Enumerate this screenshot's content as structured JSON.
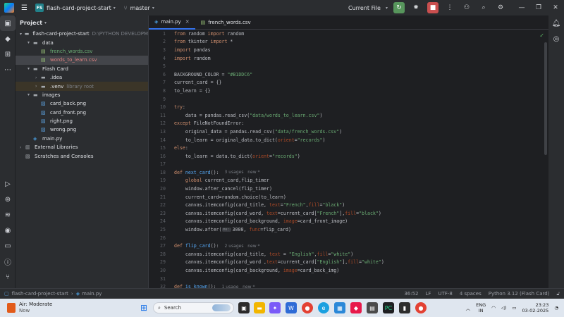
{
  "titlebar": {
    "project_badge": "FS",
    "project_name": "flash-card-project-start",
    "branch": "master",
    "run_config": "Current File"
  },
  "project_panel": {
    "header": "Project",
    "tree": [
      {
        "indent": 0,
        "arrow": "▾",
        "icon": "folder",
        "label": "flash-card-project-start",
        "note": "D:\\PYTHON DEVELOPM",
        "cls": ""
      },
      {
        "indent": 1,
        "arrow": "▾",
        "icon": "folder",
        "label": "data",
        "note": "",
        "cls": ""
      },
      {
        "indent": 2,
        "arrow": "",
        "icon": "csv",
        "label": "french_words.csv",
        "note": "",
        "cls": "green"
      },
      {
        "indent": 2,
        "arrow": "",
        "icon": "csv",
        "label": "words_to_learn.csv",
        "note": "",
        "cls": "red-sel"
      },
      {
        "indent": 1,
        "arrow": "▾",
        "icon": "folder",
        "label": "Flash Card",
        "note": "",
        "cls": ""
      },
      {
        "indent": 2,
        "arrow": "›",
        "icon": "folder",
        "label": ".idea",
        "note": "",
        "cls": ""
      },
      {
        "indent": 2,
        "arrow": "›",
        "icon": "folder",
        "label": ".venv",
        "note": "library root",
        "cls": "excl"
      },
      {
        "indent": 1,
        "arrow": "▾",
        "icon": "folder",
        "label": "images",
        "note": "",
        "cls": ""
      },
      {
        "indent": 2,
        "arrow": "",
        "icon": "png",
        "label": "card_back.png",
        "note": "",
        "cls": ""
      },
      {
        "indent": 2,
        "arrow": "",
        "icon": "png",
        "label": "card_front.png",
        "note": "",
        "cls": ""
      },
      {
        "indent": 2,
        "arrow": "",
        "icon": "png",
        "label": "right.png",
        "note": "",
        "cls": ""
      },
      {
        "indent": 2,
        "arrow": "",
        "icon": "png",
        "label": "wrong.png",
        "note": "",
        "cls": ""
      },
      {
        "indent": 1,
        "arrow": "",
        "icon": "py",
        "label": "main.py",
        "note": "",
        "cls": ""
      },
      {
        "indent": 0,
        "arrow": "›",
        "icon": "lib",
        "label": "External Libraries",
        "note": "",
        "cls": ""
      },
      {
        "indent": 0,
        "arrow": "",
        "icon": "scratch",
        "label": "Scratches and Consoles",
        "note": "",
        "cls": ""
      }
    ]
  },
  "tabs": [
    {
      "label": "main.py",
      "active": true
    },
    {
      "label": "french_words.csv",
      "active": false
    }
  ],
  "code_lines": [
    [
      [
        "kw",
        "from"
      ],
      [
        "t",
        " random "
      ],
      [
        "kw",
        "import"
      ],
      [
        "t",
        " random"
      ]
    ],
    [
      [
        "kw",
        "from"
      ],
      [
        "t",
        " tkinter "
      ],
      [
        "kw",
        "import"
      ],
      [
        "t",
        " *"
      ]
    ],
    [
      [
        "kw",
        "import"
      ],
      [
        "t",
        " pandas"
      ]
    ],
    [
      [
        "kw",
        "import"
      ],
      [
        "t",
        " random"
      ]
    ],
    [],
    [
      [
        "t",
        "BACKGROUND_COLOR = "
      ],
      [
        "str",
        "\"#B1DDC6\""
      ]
    ],
    [
      [
        "t",
        "current_card = {}"
      ]
    ],
    [
      [
        "t",
        "to_learn = {}"
      ]
    ],
    [],
    [
      [
        "kw",
        "try"
      ],
      [
        "t",
        ":"
      ]
    ],
    [
      [
        "t",
        "    data = pandas.read_csv("
      ],
      [
        "str",
        "\"data/words_to_learn.csv\""
      ],
      [
        "t",
        ")"
      ]
    ],
    [
      [
        "kw",
        "except"
      ],
      [
        "t",
        " FileNotFoundError:"
      ]
    ],
    [
      [
        "t",
        "    original_data = pandas.read_csv("
      ],
      [
        "str",
        "\"data/french_words.csv\""
      ],
      [
        "t",
        ")"
      ]
    ],
    [
      [
        "t",
        "    to_learn = original_data.to_dict("
      ],
      [
        "param",
        "orient"
      ],
      [
        "t",
        "="
      ],
      [
        "str",
        "\"records\""
      ],
      [
        "t",
        ")"
      ]
    ],
    [
      [
        "kw",
        "else"
      ],
      [
        "t",
        ":"
      ]
    ],
    [
      [
        "t",
        "    to_learn = data.to_dict("
      ],
      [
        "param",
        "orient"
      ],
      [
        "t",
        "="
      ],
      [
        "str",
        "\"records\""
      ],
      [
        "t",
        ")"
      ]
    ],
    [],
    [
      [
        "kw",
        "def "
      ],
      [
        "fn",
        "next_card"
      ],
      [
        "t",
        "():"
      ],
      [
        "hint",
        "3 usages   new *"
      ]
    ],
    [
      [
        "kw",
        "    global"
      ],
      [
        "t",
        " current_card,flip_timer"
      ]
    ],
    [
      [
        "t",
        "    window.after_cancel(flip_timer)"
      ]
    ],
    [
      [
        "t",
        "    current_card=random.choice(to_learn)"
      ]
    ],
    [
      [
        "t",
        "    canvas.itemconfig(card_title, "
      ],
      [
        "param",
        "text"
      ],
      [
        "t",
        "="
      ],
      [
        "str",
        "\"French\""
      ],
      [
        "t",
        ","
      ],
      [
        "param",
        "fill"
      ],
      [
        "t",
        "="
      ],
      [
        "str",
        "\"black\""
      ],
      [
        "t",
        ")"
      ]
    ],
    [
      [
        "t",
        "    canvas.itemconfig(card_word, "
      ],
      [
        "param",
        "text"
      ],
      [
        "t",
        "=current_card["
      ],
      [
        "str",
        "\"French\""
      ],
      [
        "t",
        "],"
      ],
      [
        "param",
        "fill"
      ],
      [
        "t",
        "="
      ],
      [
        "str",
        "\"black\""
      ],
      [
        "t",
        ")"
      ]
    ],
    [
      [
        "t",
        "    canvas.itemconfig(card_background, "
      ],
      [
        "param",
        "image"
      ],
      [
        "t",
        "=card_front_image)"
      ]
    ],
    [
      [
        "t",
        "    window.after("
      ],
      [
        "inlay",
        "ms:"
      ],
      [
        "t",
        "3000, "
      ],
      [
        "param",
        "func"
      ],
      [
        "t",
        "=flip_card)"
      ]
    ],
    [],
    [
      [
        "kw",
        "def "
      ],
      [
        "fn",
        "flip_card"
      ],
      [
        "t",
        "():"
      ],
      [
        "hint",
        "2 usages   new *"
      ]
    ],
    [
      [
        "t",
        "    canvas.itemconfig(card_title, "
      ],
      [
        "param",
        "text"
      ],
      [
        "t",
        " = "
      ],
      [
        "str",
        "\"English\""
      ],
      [
        "t",
        ","
      ],
      [
        "param",
        "fill"
      ],
      [
        "t",
        "="
      ],
      [
        "str",
        "\"white\""
      ],
      [
        "t",
        ")"
      ]
    ],
    [
      [
        "t",
        "    canvas.itemconfig(card_word ,"
      ],
      [
        "param",
        "text"
      ],
      [
        "t",
        "=current_card["
      ],
      [
        "str",
        "\"English\""
      ],
      [
        "t",
        "],"
      ],
      [
        "param",
        "fill"
      ],
      [
        "t",
        "="
      ],
      [
        "str",
        "\"white\""
      ],
      [
        "t",
        ")"
      ]
    ],
    [
      [
        "t",
        "    canvas.itemconfig(card_background, "
      ],
      [
        "param",
        "image"
      ],
      [
        "t",
        "=card_back_img)"
      ]
    ],
    [],
    [
      [
        "kw",
        "def "
      ],
      [
        "fn",
        "is_known"
      ],
      [
        "t",
        "():"
      ],
      [
        "hint",
        "1 usage   new *"
      ]
    ]
  ],
  "statusbar": {
    "path_project": "flash-card-project-start",
    "path_file": "main.py",
    "position": "36:52",
    "line_sep": "LF",
    "encoding": "UTF-8",
    "indent": "4 spaces",
    "interpreter": "Python 3.12 (Flash Card)"
  },
  "taskbar": {
    "weather_title": "Air: Moderate",
    "weather_sub": "Now",
    "search_placeholder": "Search",
    "lang_top": "ENG",
    "lang_bottom": "IN",
    "time": "23:23",
    "date": "03-02-2025"
  },
  "colors": {
    "accent": "#3574f0",
    "run": "#57965c",
    "stop": "#c94f4f"
  }
}
